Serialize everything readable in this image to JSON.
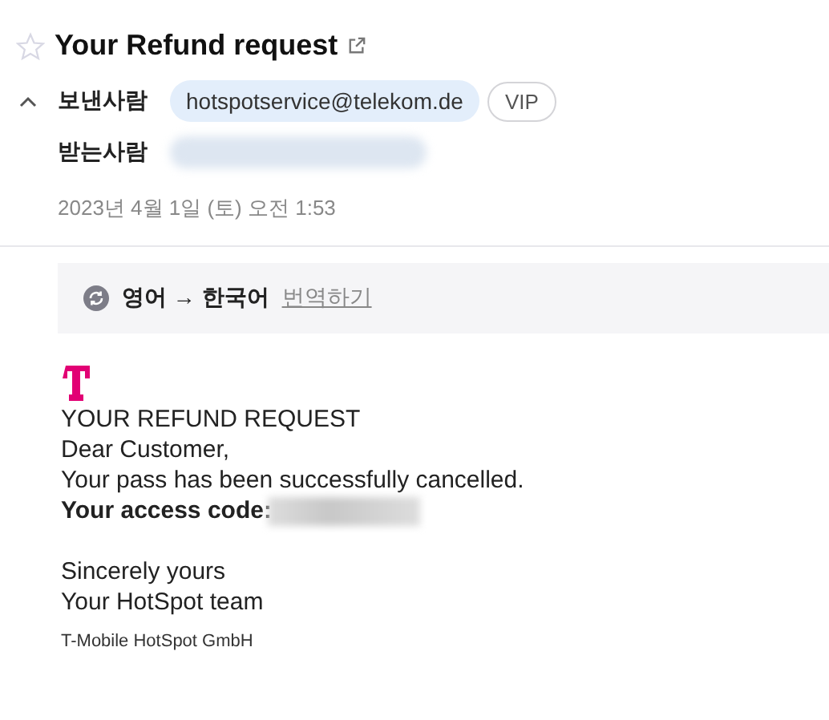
{
  "subject": {
    "title": "Your Refund request",
    "starred": false
  },
  "sender": {
    "label": "보낸사람",
    "address": "hotspotservice@telekom.de",
    "badge": "VIP",
    "expanded": true
  },
  "recipient": {
    "label": "받는사람"
  },
  "date": "2023년 4월 1일 (토) 오전 1:53",
  "translation": {
    "languages": "영어 → 한국어",
    "action": "번역하기"
  },
  "body": {
    "heading": "YOUR REFUND REQUEST",
    "lines": [
      "Dear Customer,",
      "Your pass has been successfully cancelled."
    ],
    "code_label": "Your access code:",
    "closing": [
      "Sincerely yours",
      "Your HotSpot team"
    ],
    "company": "T-Mobile HotSpot GmbH"
  }
}
